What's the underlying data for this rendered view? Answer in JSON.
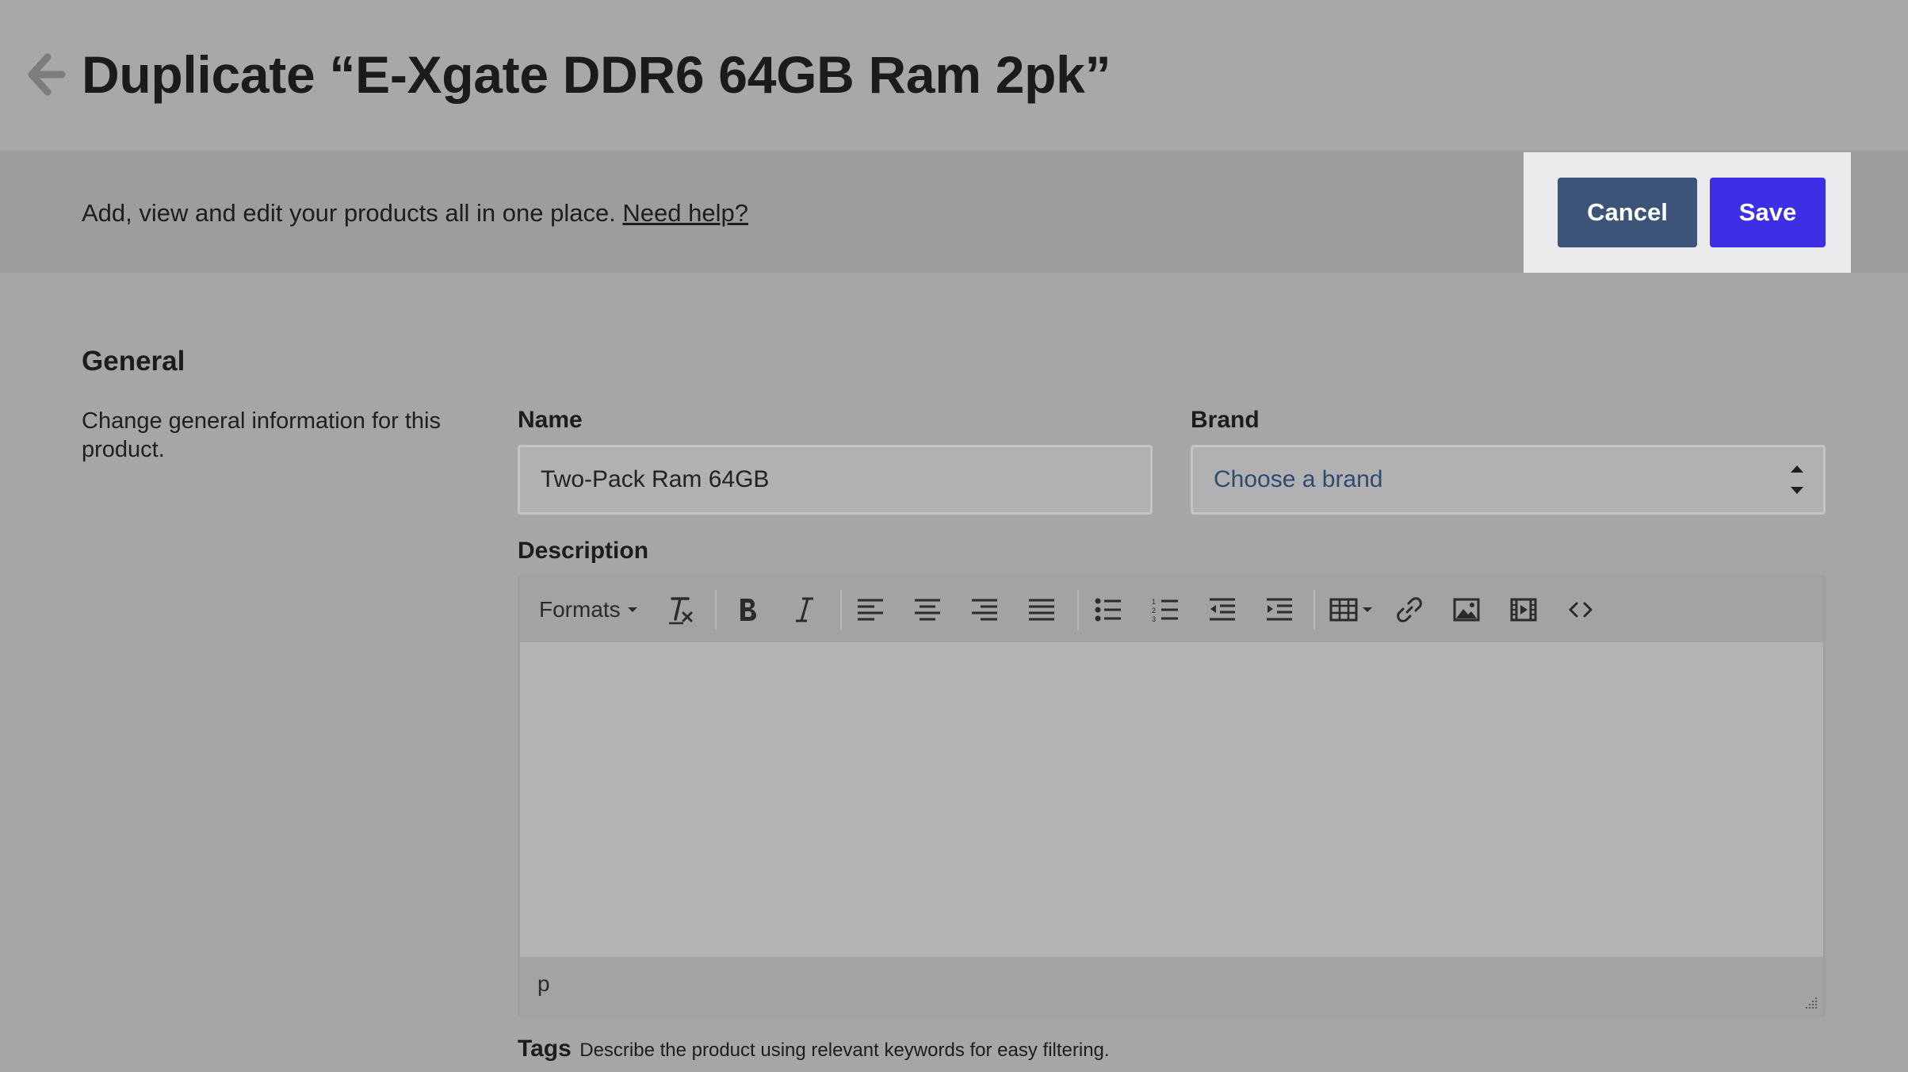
{
  "header": {
    "title": "Duplicate “E-Xgate DDR6 64GB Ram 2pk”"
  },
  "subbar": {
    "text": "Add, view and edit your products all in one place.",
    "help_link": "Need help?"
  },
  "actions": {
    "cancel_label": "Cancel",
    "save_label": "Save"
  },
  "general": {
    "title": "General",
    "description": "Change general information for this product.",
    "name_label": "Name",
    "name_value": "Two-Pack Ram 64GB",
    "brand_label": "Brand",
    "brand_placeholder": "Choose a brand",
    "description_label": "Description"
  },
  "editor": {
    "formats_label": "Formats",
    "status_path": "p",
    "toolbar_icons": [
      "clear-formatting-icon",
      "bold-icon",
      "italic-icon",
      "align-left-icon",
      "align-center-icon",
      "align-right-icon",
      "align-justify-icon",
      "bullet-list-icon",
      "numbered-list-icon",
      "outdent-icon",
      "indent-icon",
      "table-icon",
      "link-icon",
      "image-icon",
      "media-icon",
      "source-code-icon"
    ]
  },
  "tags": {
    "label": "Tags",
    "help": "Describe the product using relevant keywords for easy filtering."
  },
  "colors": {
    "save": "#3c2fe6",
    "cancel": "#3b5478",
    "overlay_bg": "#a6a6a9"
  }
}
